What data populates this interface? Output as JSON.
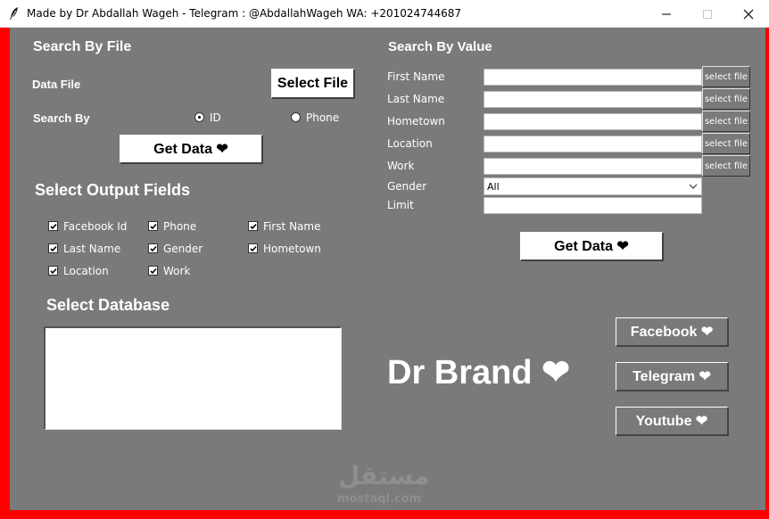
{
  "window": {
    "title": "Made by Dr Abdallah Wageh - Telegram : @AbdallahWageh   WA: +201024744687",
    "accent_border": "#ff0000",
    "panel_bg": "#7a7a7a"
  },
  "search_by_file": {
    "heading": "Search By File",
    "data_file_label": "Data File",
    "select_file_button": "Select File",
    "search_by_label": "Search By",
    "radio_options": [
      {
        "label": "ID",
        "selected": true
      },
      {
        "label": "Phone",
        "selected": false
      }
    ],
    "get_data_button": "Get Data ❤"
  },
  "output_fields": {
    "heading": "Select Output Fields",
    "fields": [
      {
        "label": "Facebook Id",
        "checked": true
      },
      {
        "label": "Phone",
        "checked": true
      },
      {
        "label": "First Name",
        "checked": true
      },
      {
        "label": "Last Name",
        "checked": true
      },
      {
        "label": "Gender",
        "checked": true
      },
      {
        "label": "Hometown",
        "checked": true
      },
      {
        "label": "Location",
        "checked": true
      },
      {
        "label": "Work",
        "checked": true
      }
    ]
  },
  "database": {
    "heading": "Select Database"
  },
  "search_by_value": {
    "heading": "Search By Value",
    "fields": [
      {
        "label": "First Name",
        "value": "",
        "button": "select file"
      },
      {
        "label": "Last Name",
        "value": "",
        "button": "select file"
      },
      {
        "label": "Hometown",
        "value": "",
        "button": "select file"
      },
      {
        "label": "Location",
        "value": "",
        "button": "select file"
      },
      {
        "label": "Work",
        "value": "",
        "button": "select file"
      }
    ],
    "gender_label": "Gender",
    "gender_value": "All",
    "limit_label": "Limit",
    "limit_value": "",
    "get_data_button": "Get Data ❤"
  },
  "brand": {
    "text": "Dr Brand ❤",
    "links": [
      "Facebook ❤",
      "Telegram ❤",
      "Youtube ❤"
    ]
  },
  "watermark": {
    "arabic": "مستقل",
    "latin": "mostaql.com"
  },
  "icons": {
    "app": "feather-icon",
    "minimize": "minimize-icon",
    "maximize": "maximize-icon",
    "close": "close-icon",
    "dropdown": "chevron-down-icon",
    "check": "check-icon"
  }
}
